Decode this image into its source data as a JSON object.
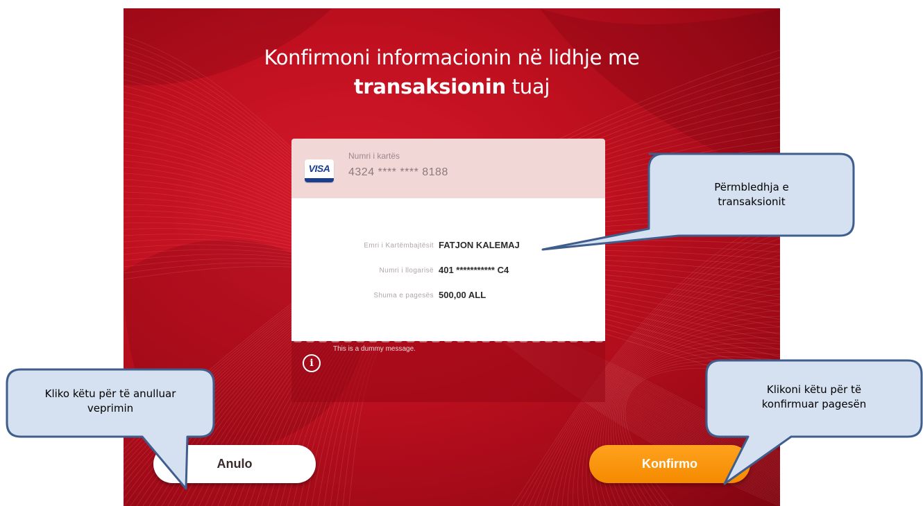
{
  "screen": {
    "title_line1": "Konfirmoni informacionin në lidhje me",
    "title_line2_bold": "transaksionin",
    "title_line2_rest": " tuaj"
  },
  "card": {
    "brand": "VISA",
    "number_label": "Numri i kartës",
    "number_value": "4324 **** **** 8188"
  },
  "details": [
    {
      "label": "Emri i Kartëmbajtësit",
      "value": "FATJON KALEMAJ"
    },
    {
      "label": "Numri i llogarisë",
      "value": "401 *********** C4"
    },
    {
      "label": "Shuma e pagesës",
      "value": "500,00 ALL"
    }
  ],
  "info": {
    "icon": "info-icon",
    "message": "This is a dummy message."
  },
  "buttons": {
    "cancel_label": "Anulo",
    "confirm_label": "Konfirmo"
  },
  "callouts": {
    "summary": "Përmbledhja e transaksionit",
    "summary_line1": "Përmbledhja e",
    "summary_line2": "transaksionit",
    "cancel_line1": "Kliko këtu për të anulluar",
    "cancel_line2": "veprimin",
    "confirm_line1": "Klikoni këtu për të",
    "confirm_line2": "konfirmuar pagesën"
  },
  "colors": {
    "screen_red": "#c0101f",
    "confirm_orange": "#f58a00",
    "callout_fill": "#d5e0f0",
    "callout_border": "#3f5e8c"
  }
}
